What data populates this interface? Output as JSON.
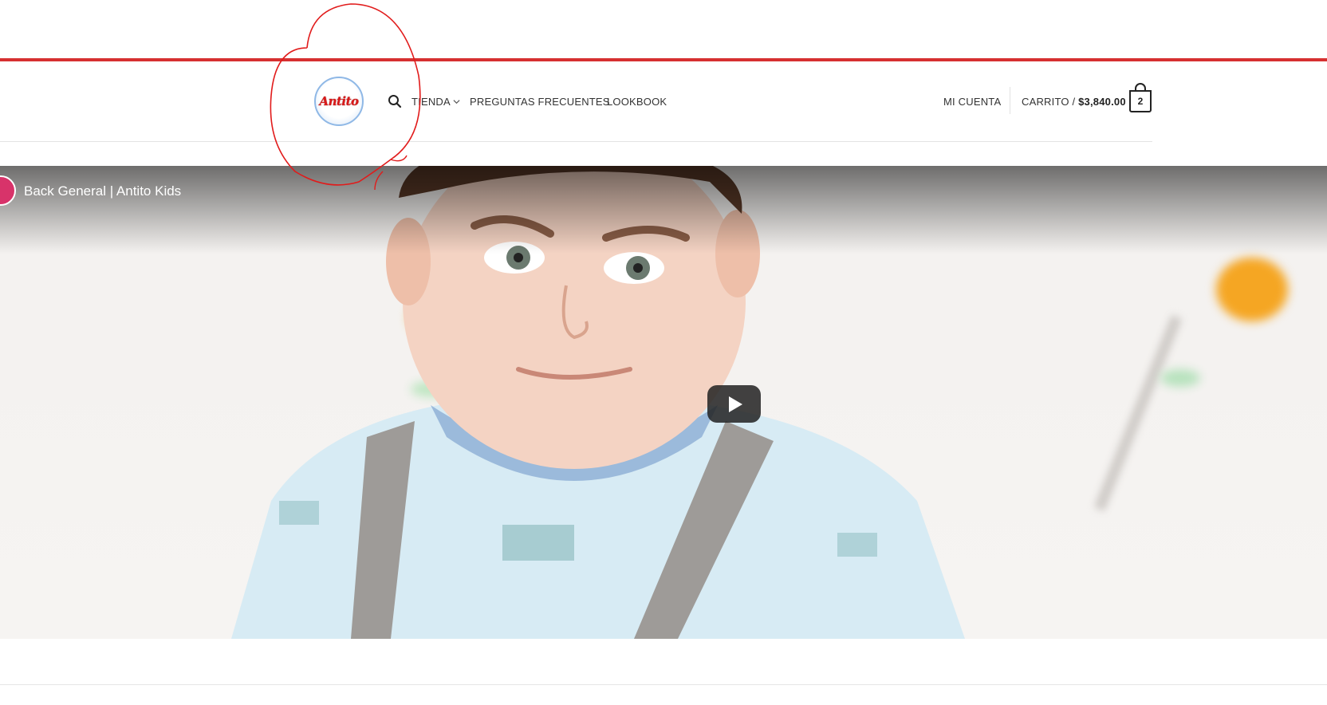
{
  "header": {
    "logo_text": "Antito",
    "nav": {
      "tienda": "TIENDA",
      "faq": "PREGUNTAS FRECUENTES",
      "lookbook": "LOOKBOOK"
    },
    "account": "MI CUENTA",
    "cart": {
      "label": "CARRITO /",
      "total": "$3,840.00",
      "count": "2"
    }
  },
  "video": {
    "title": "Back General | Antito Kids"
  },
  "colors": {
    "accent_red": "#d63031",
    "logo_red": "#d91a1a"
  }
}
